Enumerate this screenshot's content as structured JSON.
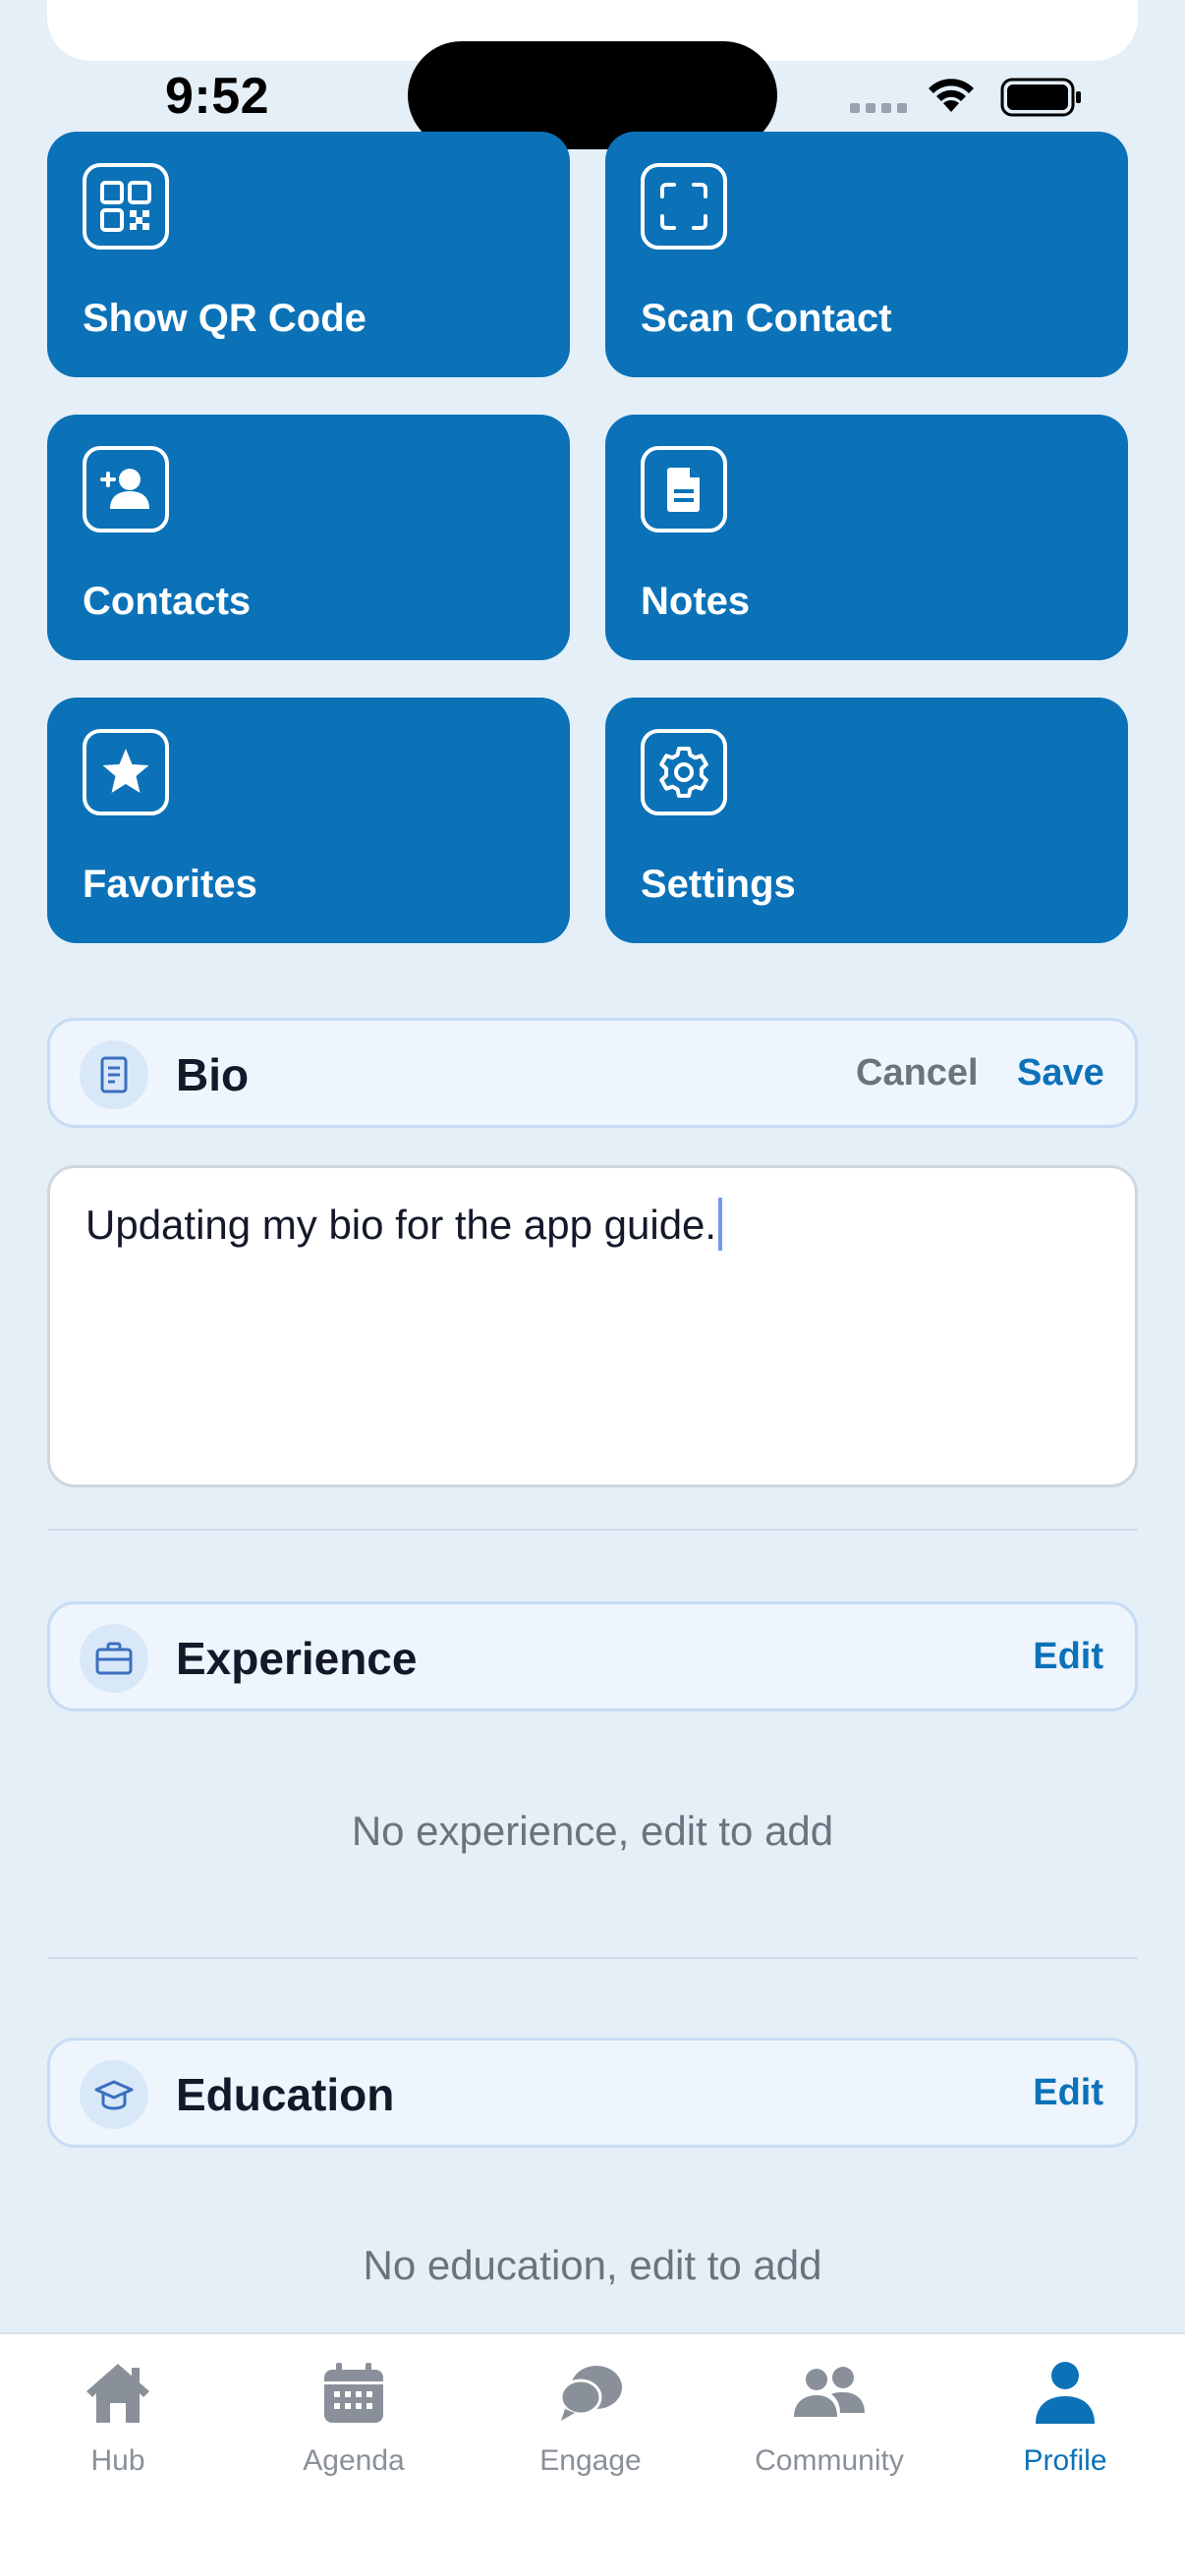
{
  "status_bar": {
    "time": "9:52"
  },
  "tiles": [
    {
      "label": "Show QR Code",
      "icon": "qr-code-icon"
    },
    {
      "label": "Scan Contact",
      "icon": "scan-frame-icon"
    },
    {
      "label": "Contacts",
      "icon": "add-contact-icon"
    },
    {
      "label": "Notes",
      "icon": "note-document-icon"
    },
    {
      "label": "Favorites",
      "icon": "star-icon"
    },
    {
      "label": "Settings",
      "icon": "gear-icon"
    }
  ],
  "bio": {
    "title": "Bio",
    "cancel_label": "Cancel",
    "save_label": "Save",
    "value": "Updating my bio for the app guide."
  },
  "experience": {
    "title": "Experience",
    "edit_label": "Edit",
    "empty_text": "No experience, edit to add"
  },
  "education": {
    "title": "Education",
    "edit_label": "Edit",
    "empty_text": "No education, edit to add"
  },
  "tabbar": {
    "items": [
      {
        "label": "Hub",
        "icon": "house-icon",
        "active": false
      },
      {
        "label": "Agenda",
        "icon": "calendar-icon",
        "active": false
      },
      {
        "label": "Engage",
        "icon": "chat-bubbles-icon",
        "active": false
      },
      {
        "label": "Community",
        "icon": "people-icon",
        "active": false
      },
      {
        "label": "Profile",
        "icon": "person-icon",
        "active": true
      }
    ]
  },
  "colors": {
    "accent": "#0b72b8",
    "background": "#e4eff8",
    "inactive": "#8a9099"
  }
}
